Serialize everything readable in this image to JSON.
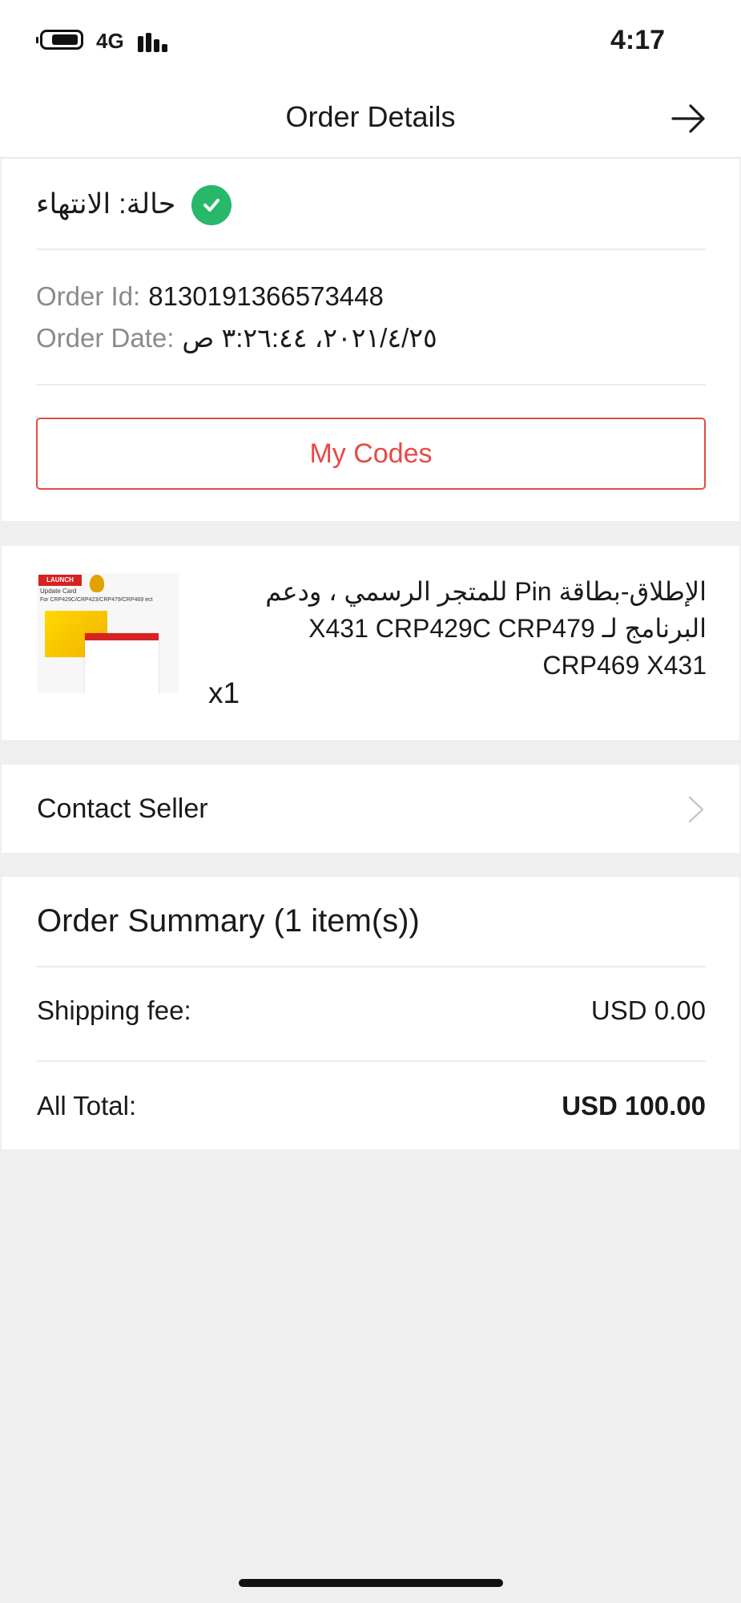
{
  "status_bar": {
    "network": "4G",
    "time": "4:17"
  },
  "header": {
    "title": "Order Details",
    "forward_icon": "arrow-right-icon"
  },
  "order": {
    "status_text": "حالة: الانتهاء",
    "status_icon": "check-circle-icon",
    "status_color": "#27b86a",
    "id_label": "Order Id:",
    "id_value": "8130191366573448",
    "date_label": "Order Date:",
    "date_value": "٢٠٢١/٤/٢٥، ٣:٢٦:٤٤ ص",
    "codes_button": "My Codes",
    "accent_color": "#e64a45"
  },
  "product": {
    "title": "الإطلاق-بطاقة Pin للمتجر الرسمي ، ودعم البرنامج لـ X431 CRP429C CRP479 CRP469 X431",
    "quantity": "x1",
    "thumbnail": {
      "brand": "LAUNCH",
      "label": "Update Card",
      "models": "For CRP429C/CRP423/CRP479/CRP469 ect"
    }
  },
  "contact": {
    "label": "Contact Seller",
    "chevron_icon": "chevron-right-icon"
  },
  "summary": {
    "title": "Order Summary (1 item(s))",
    "shipping_label": "Shipping fee:",
    "shipping_value": "USD 0.00",
    "total_label": "All Total:",
    "total_value": "USD 100.00"
  }
}
